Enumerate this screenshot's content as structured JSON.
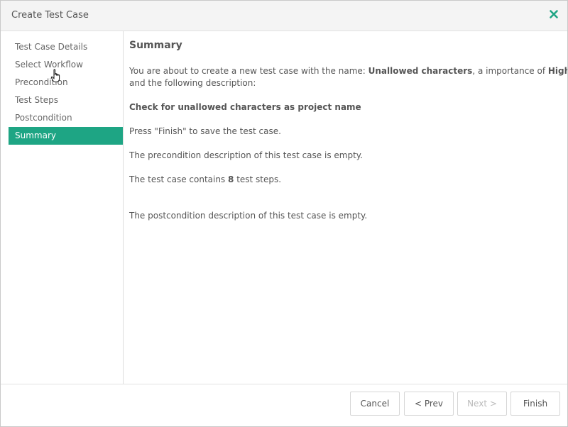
{
  "dialog": {
    "title": "Create Test Case",
    "close_icon": "close-icon"
  },
  "sidebar": {
    "items": [
      {
        "label": "Test Case Details"
      },
      {
        "label": "Select Workflow"
      },
      {
        "label": "Precondition"
      },
      {
        "label": "Test Steps"
      },
      {
        "label": "Postcondition"
      },
      {
        "label": "Summary",
        "active": true
      }
    ]
  },
  "summary": {
    "title": "Summary",
    "intro_prefix": "You are about to create a new test case with the name: ",
    "name": "Unallowed characters",
    "intro_middle": ", a importance of ",
    "importance": "High",
    "intro_suffix": "and the following description:",
    "description": "Check for unallowed characters as project name",
    "finish_hint": "Press \"Finish\" to save the test case.",
    "precondition_text": "The precondition description of this test case is empty.",
    "steps_prefix": "The test case contains ",
    "steps_count": "8",
    "steps_suffix": " test steps.",
    "postcondition_text": "The postcondition description of this test case is empty."
  },
  "footer": {
    "cancel_label": "Cancel",
    "prev_label": "< Prev",
    "next_label": "Next >",
    "finish_label": "Finish"
  },
  "colors": {
    "accent": "#1ea584",
    "close_icon": "#1ea584"
  }
}
